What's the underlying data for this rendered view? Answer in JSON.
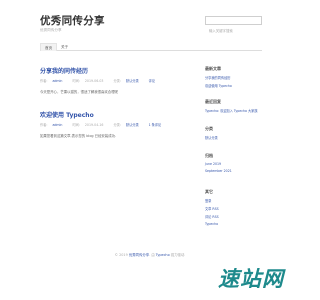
{
  "header": {
    "site_title": "优秀同传分享",
    "site_description": "优秀同传分享",
    "search_placeholder": "输入关键字搜索"
  },
  "nav": {
    "items": [
      {
        "label": "首页",
        "active": true
      },
      {
        "label": "关于",
        "active": false
      }
    ]
  },
  "posts": [
    {
      "title": "分享我的同传经历",
      "author_prefix": "作者:",
      "author": "admin",
      "date_prefix": "时间:",
      "date": "2019-06-03",
      "category_prefix": "分类:",
      "category": "默认分类",
      "comments": "评论",
      "body": "今天是开心，芒果以猫的，很适了解我很喜欢合理呢"
    },
    {
      "title": "欢迎使用 Typecho",
      "author_prefix": "作者:",
      "author": "admin",
      "date_prefix": "时间:",
      "date": "2019-04-16",
      "category_prefix": "分类:",
      "category": "默认分类",
      "comments": "1 条评论",
      "body": "如果您看到这篇文章,表示您的 blog 已经安装成功."
    }
  ],
  "sidebar": {
    "recent_posts": {
      "title": "最新文章",
      "items": [
        "分享我的同传经历",
        "欢迎使用 Typecho"
      ]
    },
    "recent_comments": {
      "title": "最近回复",
      "items": [
        "Typecho: 欢迎加入 Typecho 大家族"
      ]
    },
    "categories": {
      "title": "分类",
      "items": [
        "默认分类"
      ]
    },
    "archives": {
      "title": "归档",
      "items": [
        "June 2019",
        "September 2021"
      ]
    },
    "other": {
      "title": "其它",
      "items": [
        "登录",
        "文章 RSS",
        "评论 RSS",
        "Typecho"
      ]
    }
  },
  "footer": {
    "copyright": "© 2019",
    "site_link": "优秀同传分享",
    "powered_prefix": "由",
    "powered_link": "Typecho",
    "powered_suffix": "强力驱动."
  },
  "watermark": {
    "text": "速站网",
    "color": "#1e8a8c"
  }
}
